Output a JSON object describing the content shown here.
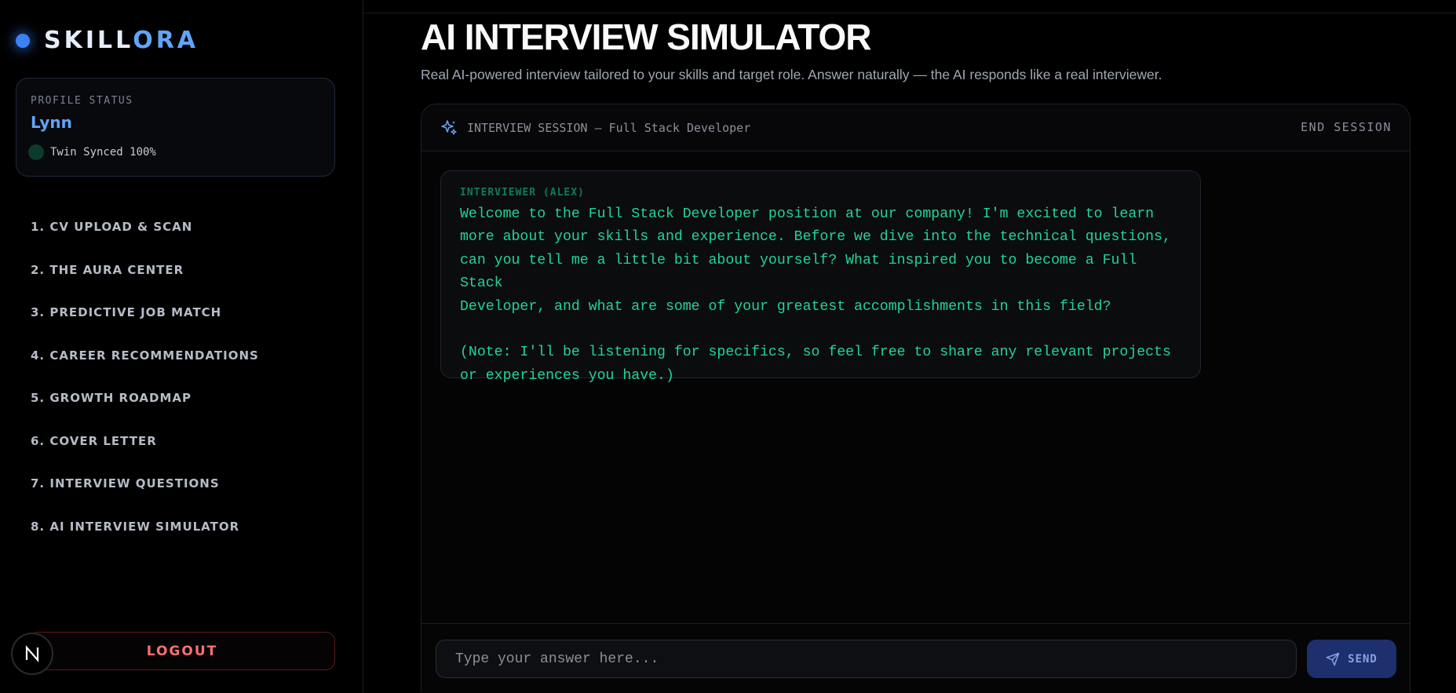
{
  "sidebar": {
    "logo": {
      "part1": "SKILL",
      "part2": "ORA"
    },
    "profile": {
      "label": "PROFILE STATUS",
      "name": "Lynn",
      "sync_status": "Twin Synced 100%"
    },
    "items": [
      {
        "label": "1. CV UPLOAD & SCAN"
      },
      {
        "label": "2. THE AURA CENTER"
      },
      {
        "label": "3. PREDICTIVE JOB MATCH"
      },
      {
        "label": "4. CAREER RECOMMENDATIONS"
      },
      {
        "label": "5. GROWTH ROADMAP"
      },
      {
        "label": "6. COVER LETTER"
      },
      {
        "label": "7. INTERVIEW QUESTIONS"
      },
      {
        "label": "8. AI INTERVIEW SIMULATOR"
      }
    ],
    "logout_label": "LOGOUT"
  },
  "main": {
    "title": "AI INTERVIEW SIMULATOR",
    "subtitle": "Real AI-powered interview tailored to your skills and target role. Answer naturally — the AI responds like a real interviewer.",
    "session": {
      "title": "INTERVIEW SESSION — Full Stack Developer",
      "end_label": "END SESSION",
      "messages": [
        {
          "sender": "INTERVIEWER (ALEX)",
          "text": "Welcome to the Full Stack Developer position at our company! I'm excited to learn\nmore about your skills and experience. Before we dive into the technical questions,\ncan you tell me a little bit about yourself? What inspired you to become a Full Stack\nDeveloper, and what are some of your greatest accomplishments in this field?\n\n(Note: I'll be listening for specifics, so feel free to share any relevant projects\nor experiences you have.)"
        }
      ],
      "input": {
        "placeholder": "Type your answer here...",
        "value": ""
      },
      "send_label": "SEND"
    }
  },
  "badge": {
    "letter": "N"
  },
  "colors": {
    "accent": "#3b82f6",
    "accent_light": "#60a5fa",
    "interviewer_text": "#22d39a",
    "logout": "#f87171",
    "send_bg": "#1e2f6e"
  }
}
